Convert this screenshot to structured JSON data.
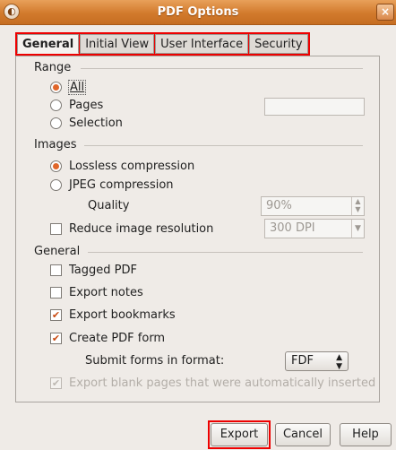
{
  "window": {
    "title": "PDF Options",
    "close_glyph": "×"
  },
  "tabs": [
    {
      "label": "General",
      "active": true
    },
    {
      "label": "Initial View",
      "active": false
    },
    {
      "label": "User Interface",
      "active": false
    },
    {
      "label": "Security",
      "active": false
    }
  ],
  "range": {
    "heading": "Range",
    "options": [
      {
        "label": "All",
        "checked": true
      },
      {
        "label": "Pages",
        "checked": false
      },
      {
        "label": "Selection",
        "checked": false
      }
    ],
    "pages_value": ""
  },
  "images": {
    "heading": "Images",
    "lossless_label": "Lossless compression",
    "jpeg_label": "JPEG compression",
    "quality_label": "Quality",
    "quality_value": "90%",
    "reduce_label": "Reduce image resolution",
    "resolution_value": "300 DPI"
  },
  "general": {
    "heading": "General",
    "tagged_pdf": "Tagged PDF",
    "export_notes": "Export notes",
    "export_bookmarks": "Export bookmarks",
    "create_pdf_form": "Create PDF form",
    "submit_format_label": "Submit forms in format:",
    "submit_format_value": "FDF",
    "export_blank": "Export blank pages that were automatically inserted"
  },
  "buttons": {
    "export": "Export",
    "cancel": "Cancel",
    "help": "Help"
  },
  "colors": {
    "title_bar": "#d27a2c",
    "highlight_box": "#ee0000",
    "checked_accent": "#e0662a"
  }
}
